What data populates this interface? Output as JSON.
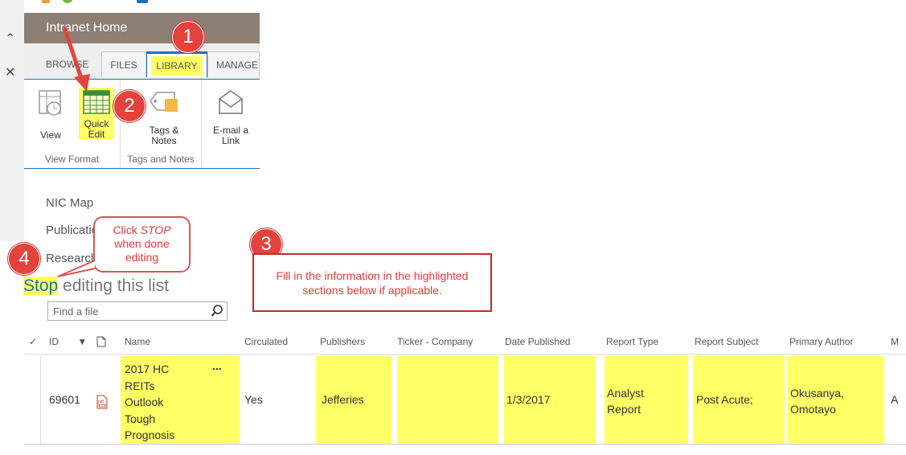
{
  "site": {
    "title": "Intranet Home"
  },
  "ribbon": {
    "tabs": [
      {
        "label": "BROWSE"
      },
      {
        "label": "FILES"
      },
      {
        "label": "LIBRARY"
      },
      {
        "label": "MANAGE"
      }
    ],
    "groups": [
      {
        "label": "View Format",
        "buttons": [
          {
            "label": "View"
          },
          {
            "label_line1": "Quick",
            "label_line2": "Edit"
          }
        ]
      },
      {
        "label": "Tags and Notes",
        "buttons": [
          {
            "label_line1": "Tags &",
            "label_line2": "Notes"
          }
        ]
      },
      {
        "label": "",
        "buttons": [
          {
            "label_line1": "E-mail a",
            "label_line2": "Link"
          }
        ]
      }
    ]
  },
  "nav": {
    "items": [
      "NIC Map",
      "Publications",
      "Research"
    ]
  },
  "stop_editing": {
    "word": "Stop",
    "rest": " editing this list"
  },
  "search": {
    "placeholder": "Find a file",
    "icon": "search-icon"
  },
  "table": {
    "columns": [
      "ID",
      "Name",
      "Circulated",
      "Publishers",
      "Ticker - Company",
      "Date Published",
      "Report Type",
      "Report Subject",
      "Primary Author",
      "M"
    ],
    "rows": [
      {
        "id": "69601",
        "name": [
          "2017 HC",
          "REITs",
          "Outlook",
          "Tough",
          "Prognosis"
        ],
        "menu": "...",
        "circulated": "Yes",
        "publishers": "Jefferies",
        "ticker": "",
        "date": "1/3/2017",
        "report_type": [
          "Analyst",
          "Report"
        ],
        "report_subject": "Post Acute;",
        "primary_author": [
          "Okusanya,",
          "Omotayo"
        ],
        "next": "A"
      }
    ]
  },
  "annotations": {
    "badges": [
      "1",
      "2",
      "3",
      "4"
    ],
    "callout3": "Fill in the information in the highlighted sections below if applicable.",
    "bubble4": {
      "line1": "Click",
      "stop": "STOP",
      "line2": "when done",
      "line3": "editing"
    }
  },
  "colors": {
    "highlight": "#ffff66",
    "accent": "#1e6fba",
    "annotation": "#e2443d",
    "titlebar": "#8e7f75"
  }
}
